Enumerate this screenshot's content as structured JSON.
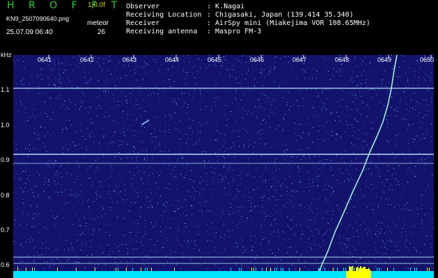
{
  "header": {
    "title": "H R O F F T",
    "version": "1.0.0f",
    "filename": "KN9_2507090640.png",
    "datetime": "25.07.09 06:40",
    "signal_label": "meteor",
    "count": "26"
  },
  "meta": [
    {
      "key": "Observer",
      "value": ": K.Nagai"
    },
    {
      "key": "Receiving Location",
      "value": ": Chigasaki, Japan (139.414 35.340)"
    },
    {
      "key": "Receiver",
      "value": ": AirSpy mini (Miakejima VOR 108.65MHz)"
    },
    {
      "key": "Receiving antenna",
      "value": ": Maspro FM-3"
    }
  ],
  "axis": {
    "unit": "kHz",
    "y_ticks": [
      "1.1",
      "1.0",
      "0.9",
      "0.8",
      "0.7",
      "0.6"
    ],
    "x_ticks": [
      "0641",
      "0642",
      "0643",
      "0644",
      "0645",
      "0646",
      "0647",
      "0648",
      "0649",
      "0650"
    ]
  },
  "colors": {
    "background": "#13136e",
    "noise": "#3a7bd8",
    "trace": "#9ff3c8",
    "bottom_band": "#00e5ff",
    "burst": "#ffff00"
  }
}
